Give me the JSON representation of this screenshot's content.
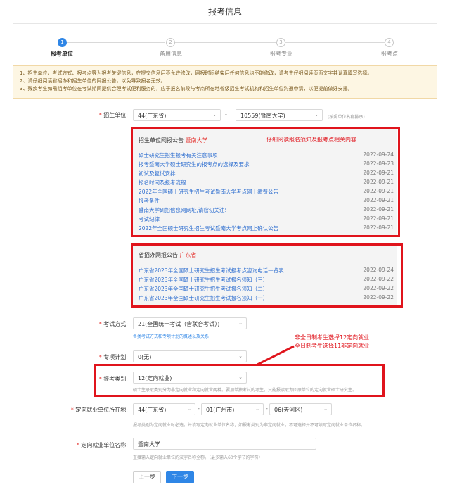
{
  "page_title": "报考信息",
  "steps": [
    {
      "num": "1",
      "label": "报考单位"
    },
    {
      "num": "2",
      "label": "备用信息"
    },
    {
      "num": "3",
      "label": "报考专业"
    },
    {
      "num": "4",
      "label": "报考点"
    }
  ],
  "notice_lines": [
    "1、招生单位、考试方式、报考点等为报考关键信息，在提交信息后不允许修改，网报时间结束后任何信息均不能修改，请考生仔细阅读页面文字并认真填写选择。",
    "2、请仔细阅读省招办和招生单位的网报公告，以免导致报名无效。",
    "3、残疾考生如需组考单位在考试期间提供合理考试便利服务的，应于报名前段与考点所在地省级招生考试机构和招生单位沟通申请，以便提前做好安排。"
  ],
  "form": {
    "unit": {
      "label": "招生单位:",
      "province": "44(广东省)",
      "school": "10559(暨南大学)",
      "hint": "(按照单位名称排序)"
    },
    "exam_mode": {
      "label": "考试方式:",
      "value": "21(全国统一考试（含联合考试）)",
      "hint": "各类考试方式和专项计划的概述以及关系"
    },
    "special_plan": {
      "label": "专项计划:",
      "value": "0(无)"
    },
    "category": {
      "label": "报考类别:",
      "value": "12(定向就业)",
      "hint": "硕士生录取类别分为非定向就业和定向就业两种。要加单独考试的考生，只能报读取为回原单位的定向就业硕士研究生。"
    },
    "employer_location": {
      "label": "定向就业单位所在地:",
      "province": "44(广东省)",
      "city": "01(广州市)",
      "district": "06(天河区)",
      "hint": "报考类别为定向就业时必选，并填写定向就业单位名称；如报考类别为非定向就业，不可选择并不可填写定向就业单位名称。"
    },
    "employer_name": {
      "label": "定向就业单位名称:",
      "value": "暨南大学",
      "hint": "直接输入定向就业单位的汉字名称全称。（最多输入60个字节的字符）"
    }
  },
  "unit_notice": {
    "title": "招生单位网报公告",
    "school": "暨南大学",
    "annotation": "仔细阅读报名须知及报考点相关内容",
    "items": [
      {
        "text": "硕士研究生招生报考有关注意事项",
        "date": "2022-09-24"
      },
      {
        "text": "报考暨南大学硕士研究生的报考点的选择及要求",
        "date": "2022-09-23"
      },
      {
        "text": "初试及复试安排",
        "date": "2022-09-21"
      },
      {
        "text": "报名时间及报考流程",
        "date": "2022-09-21"
      },
      {
        "text": "2022年全国硕士研究生招生考试暨南大学考点网上缴费公告",
        "date": "2022-09-21"
      },
      {
        "text": "报考条件",
        "date": "2022-09-21"
      },
      {
        "text": "暨南大学研招信息网网址,请密切关注!",
        "date": "2022-09-21"
      },
      {
        "text": "考试纪律",
        "date": "2022-09-21"
      },
      {
        "text": "2022年全国硕士研究生招生考试暨南大学考点网上确认公告",
        "date": "2022-09-21"
      }
    ]
  },
  "province_notice": {
    "title": "省招办网报公告",
    "province": "广东省",
    "items": [
      {
        "text": "广东省2023年全国硕士研究生招生考试报考点咨询电话一览表",
        "date": "2022-09-24"
      },
      {
        "text": "广东省2023年全国硕士研究生招生考试报名须知（三）",
        "date": "2022-09-22"
      },
      {
        "text": "广东省2023年全国硕士研究生招生考试报名须知（二）",
        "date": "2022-09-22"
      },
      {
        "text": "广东省2023年全国硕士研究生招生考试报名须知（一）",
        "date": "2022-09-22"
      }
    ]
  },
  "category_annotation": [
    "非全日制考生选择12定向就业",
    "全日制考生选择11非定向就业"
  ],
  "buttons": {
    "prev": "上一步",
    "next": "下一步"
  }
}
